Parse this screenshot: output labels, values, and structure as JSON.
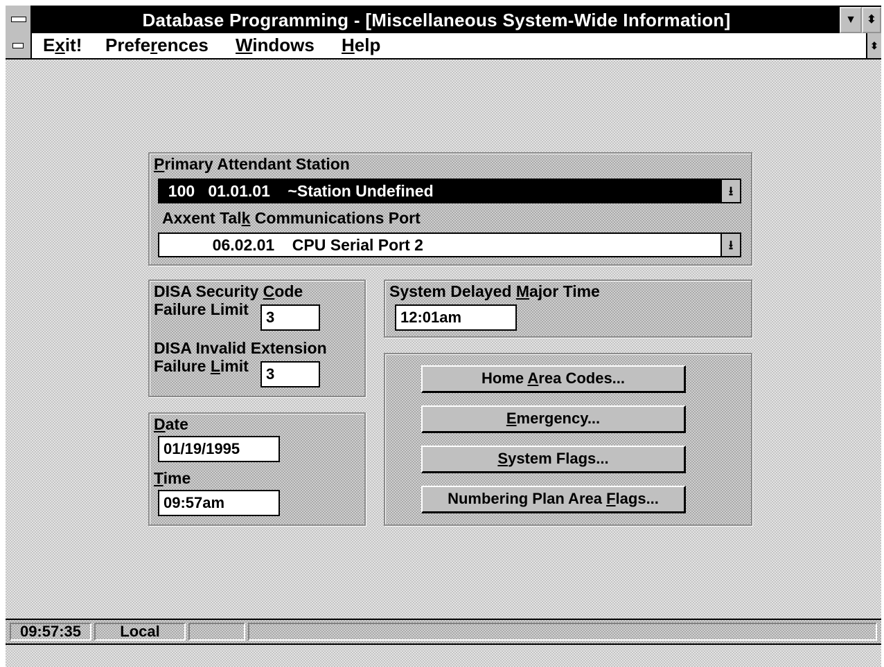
{
  "window": {
    "title": "Database Programming - [Miscellaneous System-Wide Information]",
    "minimize_glyph": "▼",
    "scroll_glyph": "⬍"
  },
  "menu": {
    "items": [
      {
        "pre": "E",
        "key": "x",
        "post": "it!"
      },
      {
        "pre": "Prefe",
        "key": "r",
        "post": "ences"
      },
      {
        "pre": "",
        "key": "W",
        "post": "indows"
      },
      {
        "pre": "",
        "key": "H",
        "post": "elp"
      }
    ]
  },
  "primary_attendant": {
    "label_pre": "",
    "label_key": "P",
    "label_post": "rimary Attendant Station",
    "value": "  100   01.01.01    ~Station Undefined"
  },
  "axxent_port": {
    "label_pre": "Axxent Tal",
    "label_key": "k",
    "label_post": " Communications Port",
    "value": "            06.02.01    CPU Serial Port 2"
  },
  "disa": {
    "security_label_pre": "DISA Security ",
    "security_label_key": "C",
    "security_label_post": "ode",
    "security_failure_label": "Failure Limit",
    "security_value": "3",
    "invalid_label": "DISA Invalid Extension",
    "invalid_failure_pre": "Failure ",
    "invalid_failure_key": "L",
    "invalid_failure_post": "imit",
    "invalid_value": "3"
  },
  "delayed_major": {
    "label_pre": "System Delayed ",
    "label_key": "M",
    "label_post": "ajor Time",
    "value": "12:01am"
  },
  "date_time": {
    "date_label_key": "D",
    "date_label_post": "ate",
    "date_value": "01/19/1995",
    "time_label_key": "T",
    "time_label_post": "ime",
    "time_value": "09:57am"
  },
  "buttons": {
    "home_pre": "Home ",
    "home_key": "A",
    "home_post": "rea Codes...",
    "emergency_key": "E",
    "emergency_post": "mergency...",
    "system_key": "S",
    "system_post": "ystem Flags...",
    "npa_pre": "Numbering Plan Area ",
    "npa_key": "F",
    "npa_post": "lags..."
  },
  "status": {
    "clock": "09:57:35",
    "mode": "Local",
    "extra": ""
  },
  "drop_glyph": "⭳"
}
